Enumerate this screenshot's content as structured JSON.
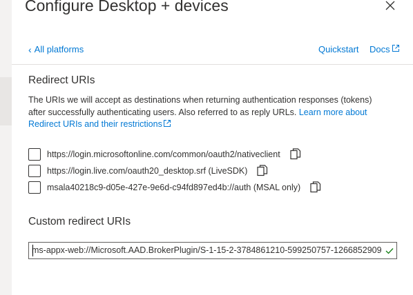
{
  "header": {
    "title": "Configure Desktop + devices",
    "close_icon": "close-icon"
  },
  "nav": {
    "back_chevron": "‹",
    "back_label": "All platforms",
    "quickstart_label": "Quickstart",
    "docs_label": "Docs"
  },
  "redirect": {
    "heading": "Redirect URIs",
    "description": "The URIs we will accept as destinations when returning authentication responses (tokens) after successfully authenticating users. Also referred to as reply URLs.",
    "learn_more": "Learn more about Redirect URIs and their restrictions",
    "uris": [
      {
        "label": "https://login.microsoftonline.com/common/oauth2/nativeclient",
        "checked": false
      },
      {
        "label": "https://login.live.com/oauth20_desktop.srf (LiveSDK)",
        "checked": false
      },
      {
        "label": "msala40218c9-d05e-427e-9e6d-c94fd897ed4b://auth (MSAL only)",
        "checked": false
      }
    ]
  },
  "custom": {
    "heading": "Custom redirect URIs",
    "value": "ms-appx-web://Microsoft.AAD.BrokerPlugin/S-1-15-2-3784861210-599250757-1266852909",
    "valid_icon": "checkmark-icon"
  },
  "colors": {
    "link": "#0078d4",
    "text": "#323130",
    "valid": "#107c10"
  }
}
